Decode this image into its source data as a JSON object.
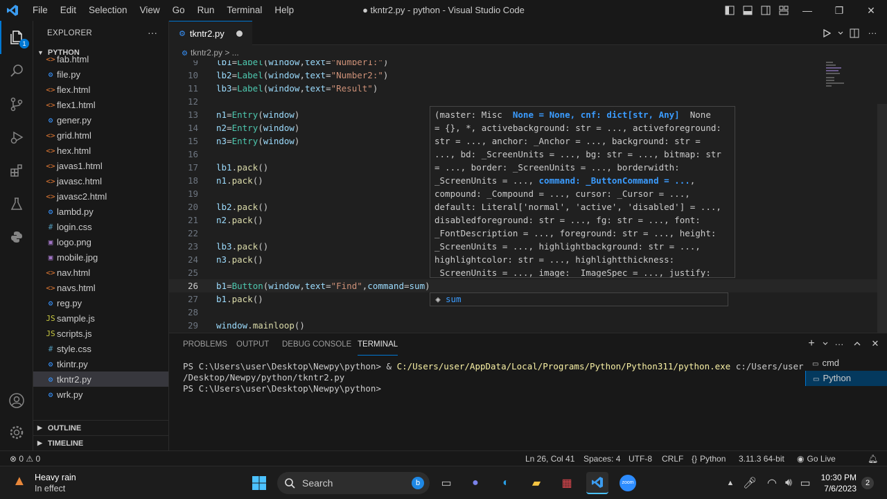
{
  "window": {
    "title": "● tkntr2.py - python - Visual Studio Code",
    "menu": [
      "File",
      "Edit",
      "Selection",
      "View",
      "Go",
      "Run",
      "Terminal",
      "Help"
    ]
  },
  "activity": {
    "badge": "1"
  },
  "explorer": {
    "header": "EXPLORER",
    "folder": "PYTHON",
    "files": [
      {
        "name": "fab.html",
        "type": "html"
      },
      {
        "name": "file.py",
        "type": "py"
      },
      {
        "name": "flex.html",
        "type": "html"
      },
      {
        "name": "flex1.html",
        "type": "html"
      },
      {
        "name": "gener.py",
        "type": "py"
      },
      {
        "name": "grid.html",
        "type": "html"
      },
      {
        "name": "hex.html",
        "type": "html"
      },
      {
        "name": "javas1.html",
        "type": "html"
      },
      {
        "name": "javasc.html",
        "type": "html"
      },
      {
        "name": "javasc2.html",
        "type": "html"
      },
      {
        "name": "lambd.py",
        "type": "py"
      },
      {
        "name": "login.css",
        "type": "css"
      },
      {
        "name": "logo.png",
        "type": "img"
      },
      {
        "name": "mobile.jpg",
        "type": "img"
      },
      {
        "name": "nav.html",
        "type": "html"
      },
      {
        "name": "navs.html",
        "type": "html"
      },
      {
        "name": "reg.py",
        "type": "py"
      },
      {
        "name": "sample.js",
        "type": "js"
      },
      {
        "name": "scripts.js",
        "type": "js"
      },
      {
        "name": "style.css",
        "type": "css"
      },
      {
        "name": "tkintr.py",
        "type": "py"
      },
      {
        "name": "tkntr2.py",
        "type": "py",
        "selected": true
      },
      {
        "name": "wrk.py",
        "type": "py"
      }
    ],
    "icons": {
      "html": "<>",
      "py": "⚙",
      "css": "#",
      "js": "JS",
      "img": "▣"
    },
    "outline": "OUTLINE",
    "timeline": "TIMELINE"
  },
  "editor": {
    "tab": "tkntr2.py",
    "breadcrumb": "tkntr2.py > ...",
    "lines": [
      {
        "n": "9",
        "code": "lb1=Label(window,text=\"Number1:\")"
      },
      {
        "n": "10",
        "code": "lb2=Label(window,text=\"Number2:\")"
      },
      {
        "n": "11",
        "code": "lb3=Label(window,text=\"Result\")"
      },
      {
        "n": "12",
        "code": ""
      },
      {
        "n": "13",
        "code": "n1=Entry(window)"
      },
      {
        "n": "14",
        "code": "n2=Entry(window)"
      },
      {
        "n": "15",
        "code": "n3=Entry(window)"
      },
      {
        "n": "16",
        "code": ""
      },
      {
        "n": "17",
        "code": "lb1.pack()"
      },
      {
        "n": "18",
        "code": "n1.pack()"
      },
      {
        "n": "19",
        "code": ""
      },
      {
        "n": "20",
        "code": "lb2.pack()"
      },
      {
        "n": "21",
        "code": "n2.pack()"
      },
      {
        "n": "22",
        "code": ""
      },
      {
        "n": "23",
        "code": "lb3.pack()"
      },
      {
        "n": "24",
        "code": "n3.pack()"
      },
      {
        "n": "25",
        "code": ""
      },
      {
        "n": "26",
        "code": "b1=Button(window,text=\"Find\",command=sum)",
        "current": true
      },
      {
        "n": "27",
        "code": "b1.pack()"
      },
      {
        "n": "28",
        "code": ""
      },
      {
        "n": "29",
        "code": "window.mainloop()"
      }
    ],
    "hover_lines": [
      "(master: Misc | None = None, cnf: dict[str, Any] | None",
      "= {}, *, activebackground: str = ..., activeforeground:",
      "str = ..., anchor: _Anchor = ..., background: str =",
      "..., bd: _ScreenUnits = ..., bg: str = ..., bitmap: str",
      "= ..., border: _ScreenUnits = ..., borderwidth:",
      "_ScreenUnits = ..., |command: _ButtonCommand = ...|,",
      "compound: _Compound = ..., cursor: _Cursor = ...,",
      "default: Literal['normal', 'active', 'disabled'] = ...,",
      "disabledforeground: str = ..., fg: str = ..., font:",
      "_FontDescription = ..., foreground: str = ..., height:",
      "_ScreenUnits = ..., highlightbackground: str = ...,",
      "highlightcolor: str = ..., highlightthickness:",
      "_ScreenUnits = ..., image: _ImageSpec = ..., justify:"
    ],
    "suggestion": "sum"
  },
  "panel": {
    "tabs": [
      "PROBLEMS",
      "OUTPUT",
      "DEBUG CONSOLE",
      "TERMINAL"
    ],
    "active_tab": "TERMINAL",
    "terminal": {
      "line1_prefix": "PS C:\\Users\\user\\Desktop\\Newpy\\python> & ",
      "line1_exe": "C:/Users/user/AppData/Local/Programs/Python/Python311/python.exe",
      "line1_suffix": " c:/Users/user",
      "line2": "/Desktop/Newpy/python/tkntr2.py",
      "line3": "PS C:\\Users\\user\\Desktop\\Newpy\\python>"
    },
    "terminals": [
      "cmd",
      "Python"
    ]
  },
  "status": {
    "problems": "⊗ 0 ⚠ 0",
    "position": "Ln 26, Col 41",
    "spaces": "Spaces: 4",
    "encoding": "UTF-8",
    "eol": "CRLF",
    "language": "Python",
    "interpreter": "3.11.3 64-bit",
    "golive": "Go Live"
  },
  "taskbar": {
    "weather_title": "Heavy rain",
    "weather_sub": "In effect",
    "search": "Search",
    "time": "10:30 PM",
    "date": "7/6/2023",
    "notif": "2"
  }
}
